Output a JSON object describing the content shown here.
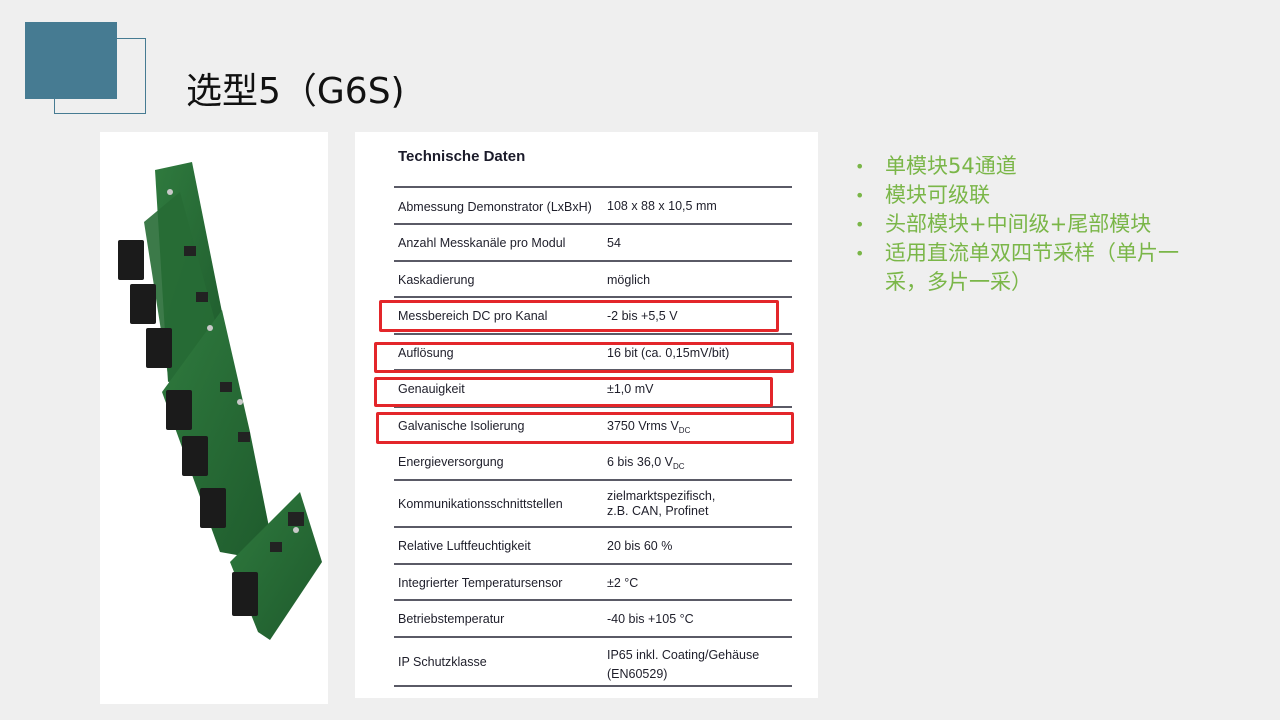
{
  "slide": {
    "title": "选型5（G6S)"
  },
  "table": {
    "heading": "Technische Daten",
    "rows": [
      {
        "label": "Abmessung Demonstrator (LxBxH)",
        "value": "108 x 88 x 10,5 mm"
      },
      {
        "label": "Anzahl Messkanäle pro Modul",
        "value": "54"
      },
      {
        "label": "Kaskadierung",
        "value": "möglich"
      },
      {
        "label": "Messbereich DC pro Kanal",
        "value": "-2 bis +5,5 V"
      },
      {
        "label": "Auflösung",
        "value": "16 bit (ca. 0,15mV/bit)"
      },
      {
        "label": "Genauigkeit",
        "value": "±1,0 mV"
      },
      {
        "label": "Galvanische Isolierung",
        "value": "3750 Vrms V",
        "sub": "DC"
      },
      {
        "label": "Energieversorgung",
        "value": "6 bis 36,0 V",
        "sub": "DC"
      },
      {
        "label": "Kommunikationsschnittstellen",
        "value": "zielmarktspezifisch,",
        "value2": "z.B. CAN, Profinet"
      },
      {
        "label": "Relative Luftfeuchtigkeit",
        "value": "20 bis 60 %"
      },
      {
        "label": "Integrierter Temperatursensor",
        "value": "±2 °C"
      },
      {
        "label": "Betriebstemperatur",
        "value": "-40 bis +105 °C"
      },
      {
        "label": "IP Schutzklasse",
        "value": "IP65 inkl. Coating/Gehäuse",
        "value2": "(EN60529)"
      }
    ]
  },
  "bullets": [
    "单模块54通道",
    "模块可级联",
    "头部模块+中间级+尾部模块",
    "适用直流单双四节采样（单片一采，多片一采）"
  ],
  "bullet_symbol": "•",
  "colors": {
    "accent_block": "#467b92",
    "bullet_text": "#7ab648",
    "highlight": "#e3262a",
    "slide_bg": "#efefef"
  }
}
